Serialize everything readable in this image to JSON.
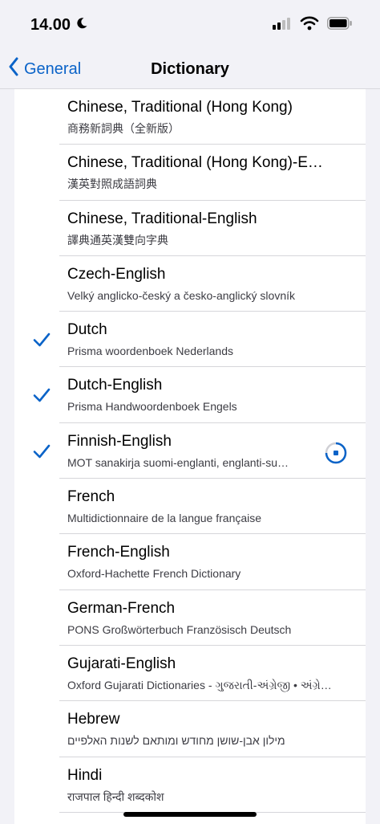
{
  "status": {
    "time": "14.00"
  },
  "nav": {
    "back_label": "General",
    "title": "Dictionary"
  },
  "dictionaries": [
    {
      "name": "Chinese, Traditional (Hong Kong)",
      "subtitle": "商務新詞典（全新版）",
      "selected": false,
      "downloading": false
    },
    {
      "name": "Chinese, Traditional (Hong Kong)-E…",
      "subtitle": "漢英對照成語詞典",
      "selected": false,
      "downloading": false
    },
    {
      "name": "Chinese, Traditional-English",
      "subtitle": "譯典通英漢雙向字典",
      "selected": false,
      "downloading": false
    },
    {
      "name": "Czech-English",
      "subtitle": "Velký anglicko-český a česko-anglický slovník",
      "selected": false,
      "downloading": false
    },
    {
      "name": "Dutch",
      "subtitle": "Prisma woordenboek Nederlands",
      "selected": true,
      "downloading": false
    },
    {
      "name": "Dutch-English",
      "subtitle": "Prisma Handwoordenboek Engels",
      "selected": true,
      "downloading": false
    },
    {
      "name": "Finnish-English",
      "subtitle": "MOT sanakirja suomi-englanti, englanti-su…",
      "selected": true,
      "downloading": true
    },
    {
      "name": "French",
      "subtitle": "Multidictionnaire de la langue française",
      "selected": false,
      "downloading": false
    },
    {
      "name": "French-English",
      "subtitle": "Oxford-Hachette French Dictionary",
      "selected": false,
      "downloading": false
    },
    {
      "name": "German-French",
      "subtitle": "PONS Großwörterbuch Französisch Deutsch",
      "selected": false,
      "downloading": false
    },
    {
      "name": "Gujarati-English",
      "subtitle": "Oxford Gujarati Dictionaries - ગુજરાતી-અંગ્રેજી • અંગ્રે…",
      "selected": false,
      "downloading": false
    },
    {
      "name": "Hebrew",
      "subtitle": "מילון אבן-שושן מחודש ומותאם לשנות האלפיים",
      "selected": false,
      "downloading": false
    },
    {
      "name": "Hindi",
      "subtitle": "राजपाल हिन्दी शब्दकोश",
      "selected": false,
      "downloading": false
    }
  ],
  "colors": {
    "accent": "#0a63c8",
    "background": "#f2f2f7",
    "list_bg": "#ffffff"
  }
}
